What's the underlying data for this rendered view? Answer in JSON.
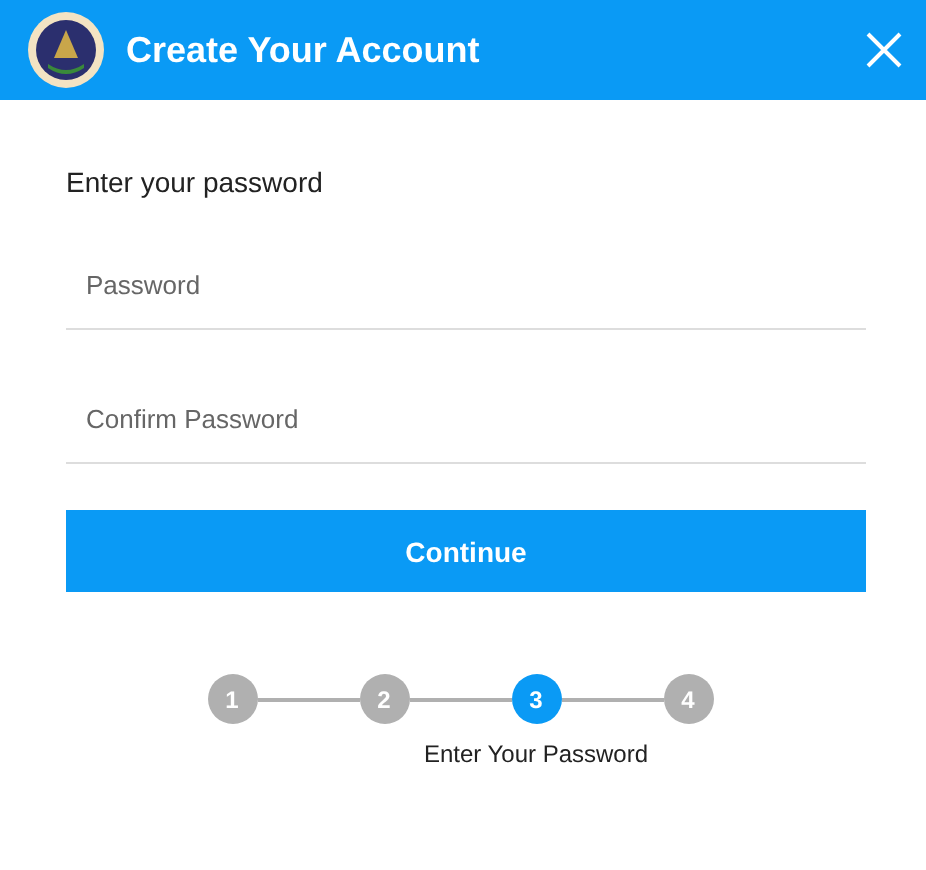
{
  "header": {
    "title": "Create Your Account"
  },
  "form": {
    "prompt": "Enter your password",
    "fields": [
      {
        "placeholder": "Password"
      },
      {
        "placeholder": "Confirm Password"
      }
    ],
    "button": "Continue"
  },
  "steps": [
    {
      "label": "1",
      "selected": false
    },
    {
      "label": "2",
      "selected": false
    },
    {
      "label": "3",
      "selected": true,
      "caption": "Enter Your Password"
    },
    {
      "label": "4",
      "selected": false
    }
  ]
}
